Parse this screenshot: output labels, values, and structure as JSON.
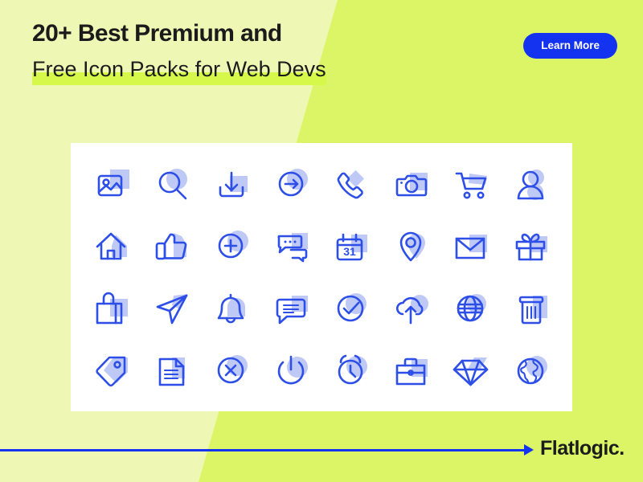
{
  "header": {
    "title_line1": "20+ Best Premium and",
    "title_line2": "Free Icon Packs for Web Devs",
    "cta_label": "Learn More"
  },
  "footer": {
    "brand": "Flatlogic."
  },
  "colors": {
    "background_light": "#EEF8B4",
    "background_bright": "#DCF566",
    "highlight": "#D6F84A",
    "accent_blue": "#1433F0",
    "icon_stroke": "#2D4FE8",
    "icon_accent": "#BFC9F6",
    "card": "#FFFFFF",
    "text": "#1B1B1B"
  },
  "icon_grid": {
    "rows": 4,
    "columns": 8,
    "icons": [
      {
        "name": "image-icon",
        "label": "Image"
      },
      {
        "name": "search-icon",
        "label": "Search"
      },
      {
        "name": "download-icon",
        "label": "Download"
      },
      {
        "name": "arrow-right-circle-icon",
        "label": "Arrow Right"
      },
      {
        "name": "phone-icon",
        "label": "Phone"
      },
      {
        "name": "camera-icon",
        "label": "Camera"
      },
      {
        "name": "shopping-cart-icon",
        "label": "Shopping Cart"
      },
      {
        "name": "user-icon",
        "label": "User"
      },
      {
        "name": "home-icon",
        "label": "Home"
      },
      {
        "name": "thumbs-up-icon",
        "label": "Thumbs Up"
      },
      {
        "name": "plus-circle-icon",
        "label": "Add"
      },
      {
        "name": "chat-bubbles-icon",
        "label": "Chat"
      },
      {
        "name": "calendar-icon",
        "label": "Calendar",
        "day": "31"
      },
      {
        "name": "location-pin-icon",
        "label": "Location"
      },
      {
        "name": "envelope-icon",
        "label": "Mail"
      },
      {
        "name": "gift-icon",
        "label": "Gift"
      },
      {
        "name": "shopping-bag-icon",
        "label": "Shopping Bag"
      },
      {
        "name": "paper-plane-icon",
        "label": "Send"
      },
      {
        "name": "bell-icon",
        "label": "Notifications"
      },
      {
        "name": "message-icon",
        "label": "Message"
      },
      {
        "name": "check-circle-icon",
        "label": "Check"
      },
      {
        "name": "cloud-upload-icon",
        "label": "Cloud Upload"
      },
      {
        "name": "globe-grid-icon",
        "label": "Globe"
      },
      {
        "name": "trash-icon",
        "label": "Delete"
      },
      {
        "name": "tag-icon",
        "label": "Tag"
      },
      {
        "name": "document-icon",
        "label": "Document"
      },
      {
        "name": "close-circle-icon",
        "label": "Close"
      },
      {
        "name": "power-icon",
        "label": "Power"
      },
      {
        "name": "alarm-clock-icon",
        "label": "Alarm"
      },
      {
        "name": "briefcase-icon",
        "label": "Briefcase"
      },
      {
        "name": "diamond-icon",
        "label": "Diamond"
      },
      {
        "name": "earth-icon",
        "label": "Earth"
      }
    ]
  }
}
